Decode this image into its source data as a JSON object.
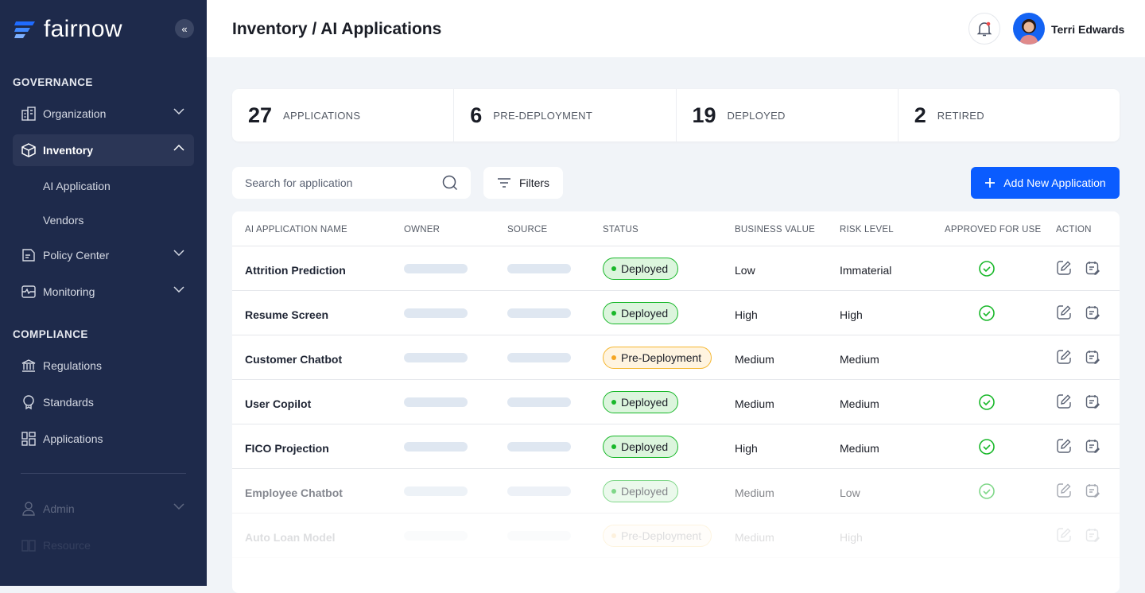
{
  "brand": {
    "name": "fairnow",
    "collapse_icon": "double-chevron-left-icon"
  },
  "sidebar": {
    "governance_label": "GOVERNANCE",
    "compliance_label": "COMPLIANCE",
    "organization": "Organization",
    "inventory": "Inventory",
    "inventory_sub": [
      "AI Application",
      "Vendors"
    ],
    "policy_center": "Policy Center",
    "monitoring": "Monitoring",
    "regulations": "Regulations",
    "standards": "Standards",
    "applications": "Applications",
    "admin": "Admin",
    "resource": "Resource"
  },
  "header": {
    "title": "Inventory / AI Applications",
    "user_name": "Terri Edwards",
    "has_notification": true
  },
  "stats": [
    {
      "value": "27",
      "label": "APPLICATIONS"
    },
    {
      "value": "6",
      "label": "PRE-DEPLOYMENT"
    },
    {
      "value": "19",
      "label": "DEPLOYED"
    },
    {
      "value": "2",
      "label": "RETIRED"
    }
  ],
  "toolbar": {
    "search_placeholder": "Search for application",
    "filters_label": "Filters",
    "add_label": "Add New Application"
  },
  "colors": {
    "sidebar": "#1e2a4b",
    "accent": "#0a5cff",
    "deployed": "#19b82a",
    "pre_deployment": "#f5a623"
  },
  "table": {
    "columns": [
      "AI APPLICATION NAME",
      "OWNER",
      "SOURCE",
      "STATUS",
      "BUSINESS VALUE",
      "RISK LEVEL",
      "APPROVED FOR USE",
      "ACTION"
    ],
    "rows": [
      {
        "name": "Attrition Prediction",
        "status": "Deployed",
        "business_value": "Low",
        "risk_level": "Immaterial",
        "approved": true
      },
      {
        "name": "Resume Screen",
        "status": "Deployed",
        "business_value": "High",
        "risk_level": "High",
        "approved": true
      },
      {
        "name": "Customer Chatbot",
        "status": "Pre-Deployment",
        "business_value": "Medium",
        "risk_level": "Medium",
        "approved": false
      },
      {
        "name": "User Copilot",
        "status": "Deployed",
        "business_value": "Medium",
        "risk_level": "Medium",
        "approved": true
      },
      {
        "name": "FICO Projection",
        "status": "Deployed",
        "business_value": "High",
        "risk_level": "Medium",
        "approved": true
      },
      {
        "name": "Employee Chatbot",
        "status": "Deployed",
        "business_value": "Medium",
        "risk_level": "Low",
        "approved": true
      },
      {
        "name": "Auto Loan Model",
        "status": "Pre-Deployment",
        "business_value": "Medium",
        "risk_level": "High",
        "approved": false
      }
    ]
  }
}
